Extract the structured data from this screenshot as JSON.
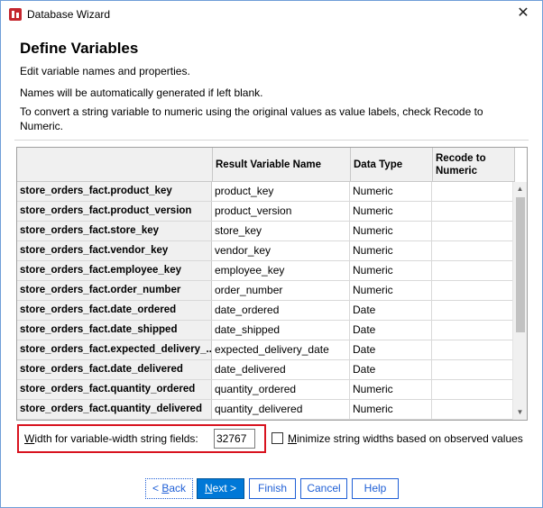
{
  "window": {
    "title": "Database Wizard",
    "close_glyph": "✕"
  },
  "page": {
    "heading": "Define Variables",
    "line1": "Edit variable names and properties.",
    "line2": "Names will be automatically generated if left blank.",
    "line3": "To convert a string variable to numeric using the original values as value labels, check Recode to",
    "line3b": "Numeric."
  },
  "grid": {
    "headers": [
      "",
      "Result Variable Name",
      "Data Type",
      "Recode to Numeric"
    ],
    "rows": [
      {
        "source": "store_orders_fact.product_key",
        "result": "product_key",
        "type": "Numeric",
        "recode": ""
      },
      {
        "source": "store_orders_fact.product_version",
        "result": "product_version",
        "type": "Numeric",
        "recode": ""
      },
      {
        "source": "store_orders_fact.store_key",
        "result": "store_key",
        "type": "Numeric",
        "recode": ""
      },
      {
        "source": "store_orders_fact.vendor_key",
        "result": "vendor_key",
        "type": "Numeric",
        "recode": ""
      },
      {
        "source": "store_orders_fact.employee_key",
        "result": "employee_key",
        "type": "Numeric",
        "recode": ""
      },
      {
        "source": "store_orders_fact.order_number",
        "result": "order_number",
        "type": "Numeric",
        "recode": ""
      },
      {
        "source": "store_orders_fact.date_ordered",
        "result": "date_ordered",
        "type": "Date",
        "recode": ""
      },
      {
        "source": "store_orders_fact.date_shipped",
        "result": "date_shipped",
        "type": "Date",
        "recode": ""
      },
      {
        "source": "store_orders_fact.expected_delivery_...",
        "result": "expected_delivery_date",
        "type": "Date",
        "recode": ""
      },
      {
        "source": "store_orders_fact.date_delivered",
        "result": "date_delivered",
        "type": "Date",
        "recode": ""
      },
      {
        "source": "store_orders_fact.quantity_ordered",
        "result": "quantity_ordered",
        "type": "Numeric",
        "recode": ""
      },
      {
        "source": "store_orders_fact.quantity_delivered",
        "result": "quantity_delivered",
        "type": "Numeric",
        "recode": ""
      }
    ]
  },
  "width_field": {
    "label_underlined": "W",
    "label_rest": "idth for variable-width string fields:",
    "value": "32767"
  },
  "minimize": {
    "label_underlined": "M",
    "label_rest": "inimize string widths based on observed values",
    "checked": false
  },
  "buttons": {
    "back_prefix": "< ",
    "back_underlined": "B",
    "back_rest": "ack",
    "next_underlined": "N",
    "next_rest": "ext >",
    "finish": "Finish",
    "cancel": "Cancel",
    "help": "Help"
  },
  "colors": {
    "accent": "#0078d7",
    "highlight_box": "#d8131f"
  }
}
